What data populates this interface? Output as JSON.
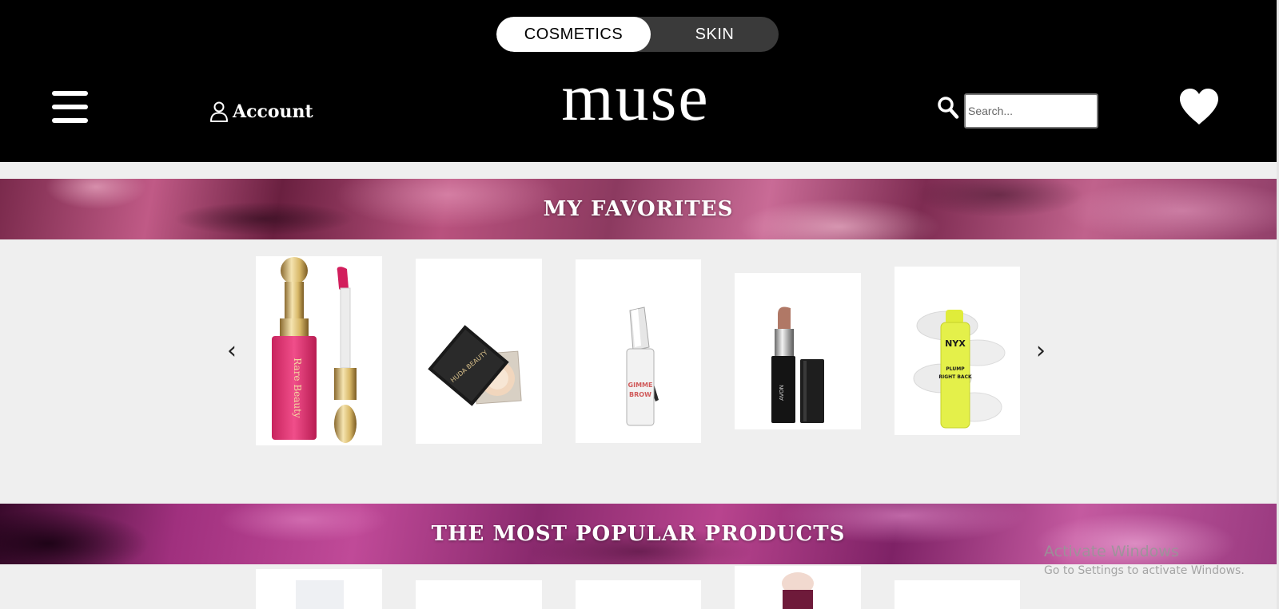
{
  "header": {
    "toggle": {
      "active": "COSMETICS",
      "inactive": "SKIN"
    },
    "account_label": "Account",
    "logo": "muse",
    "search_placeholder": "Search..."
  },
  "sections": {
    "favorites_title": "MY FAVORITES",
    "popular_title": "THE MOST POPULAR PRODUCTS"
  },
  "carousel": {
    "prev": "‹",
    "next": "›",
    "favorites": [
      {
        "name": "rare-beauty-liquid-blush",
        "brand_text": "Rare Beauty",
        "accent": "#e83e7a"
      },
      {
        "name": "huda-beauty-powder-compact",
        "brand_text": "HUDA BEAUTY",
        "accent": "#1a1a1a"
      },
      {
        "name": "benefit-gimme-brow-gel",
        "brand_text": "GIMME BROW",
        "accent": "#c8c8c8"
      },
      {
        "name": "avon-lipstick",
        "brand_text": "AVON",
        "accent": "#a8695c"
      },
      {
        "name": "nyx-plump-right-back-serum",
        "brand_text": "NYX",
        "accent": "#e4f04a"
      }
    ]
  },
  "watermark": {
    "title": "Activate Windows",
    "subtitle": "Go to Settings to activate Windows."
  },
  "colors": {
    "header_bg": "#000000",
    "page_bg": "#efefef",
    "banner_pink": "#c05a86",
    "banner_magenta": "#b8448e"
  }
}
